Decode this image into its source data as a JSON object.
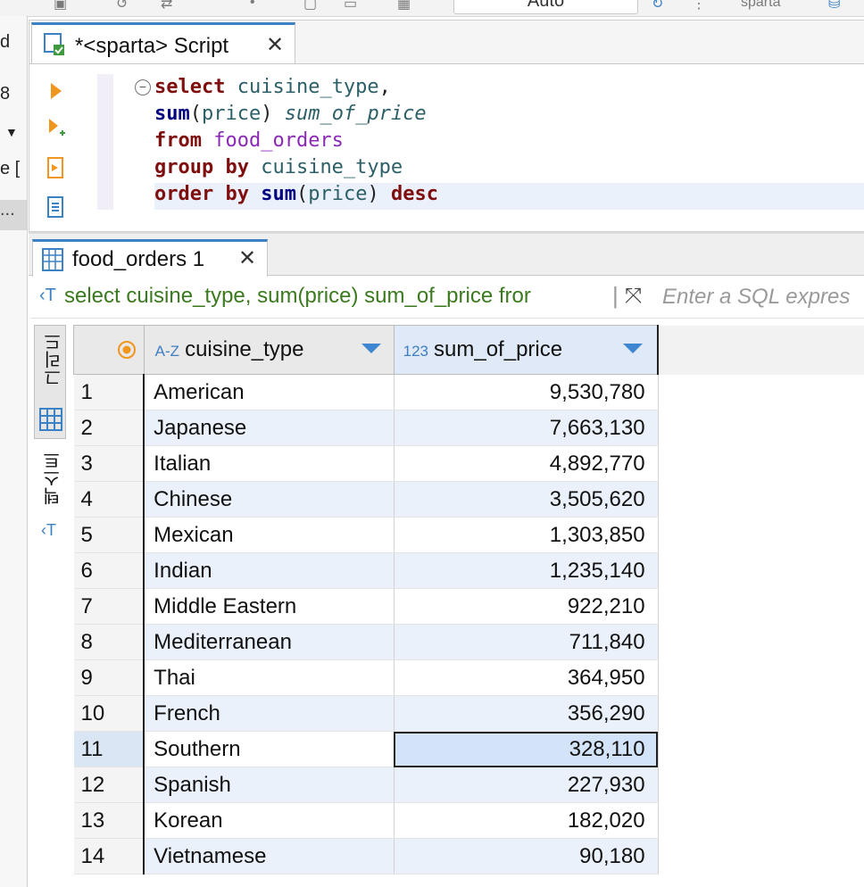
{
  "toolbar": {
    "auto_label": "Auto",
    "connection_label": "sparta"
  },
  "leftstrip": {
    "items": [
      "d",
      "8",
      "▼",
      "e [",
      "..."
    ]
  },
  "editor": {
    "tab_title": "*<sparta> Script",
    "code_lines": [
      [
        {
          "t": "select",
          "c": "kw"
        },
        {
          "t": " cuisine_type",
          "c": "col"
        },
        {
          "t": ",",
          "c": "punc"
        }
      ],
      [
        {
          "t": "sum",
          "c": "fn"
        },
        {
          "t": "(",
          "c": "punc"
        },
        {
          "t": "price",
          "c": "col"
        },
        {
          "t": ") ",
          "c": "punc"
        },
        {
          "t": "sum_of_price",
          "c": "alias"
        }
      ],
      [
        {
          "t": "from",
          "c": "kw"
        },
        {
          "t": " food_orders",
          "c": "tbl"
        }
      ],
      [
        {
          "t": "group by",
          "c": "kw"
        },
        {
          "t": " cuisine_type",
          "c": "col"
        }
      ],
      [
        {
          "t": "order by",
          "c": "kw"
        },
        {
          "t": " ",
          "c": "punc"
        },
        {
          "t": "sum",
          "c": "fn"
        },
        {
          "t": "(",
          "c": "punc"
        },
        {
          "t": "price",
          "c": "col"
        },
        {
          "t": ") ",
          "c": "punc"
        },
        {
          "t": "desc",
          "c": "kw"
        }
      ]
    ]
  },
  "results": {
    "tab_title": "food_orders 1",
    "filter_sql": "select cuisine_type, sum(price) sum_of_price fror",
    "filter_placeholder": "Enter a SQL expres",
    "side_tabs": {
      "grid": "그리드",
      "text": "텍스트"
    },
    "columns": [
      {
        "type_label": "A-Z",
        "name": "cuisine_type"
      },
      {
        "type_label": "123",
        "name": "sum_of_price"
      }
    ],
    "rows": [
      {
        "n": "1",
        "cuisine": "American",
        "sum": "9,530,780"
      },
      {
        "n": "2",
        "cuisine": "Japanese",
        "sum": "7,663,130"
      },
      {
        "n": "3",
        "cuisine": "Italian",
        "sum": "4,892,770"
      },
      {
        "n": "4",
        "cuisine": "Chinese",
        "sum": "3,505,620"
      },
      {
        "n": "5",
        "cuisine": "Mexican",
        "sum": "1,303,850"
      },
      {
        "n": "6",
        "cuisine": "Indian",
        "sum": "1,235,140"
      },
      {
        "n": "7",
        "cuisine": "Middle Eastern",
        "sum": "922,210"
      },
      {
        "n": "8",
        "cuisine": "Mediterranean",
        "sum": "711,840"
      },
      {
        "n": "9",
        "cuisine": "Thai",
        "sum": "364,950"
      },
      {
        "n": "10",
        "cuisine": "French",
        "sum": "356,290"
      },
      {
        "n": "11",
        "cuisine": "Southern",
        "sum": "328,110"
      },
      {
        "n": "12",
        "cuisine": "Spanish",
        "sum": "227,930"
      },
      {
        "n": "13",
        "cuisine": "Korean",
        "sum": "182,020"
      },
      {
        "n": "14",
        "cuisine": "Vietnamese",
        "sum": "90,180"
      }
    ],
    "selected_row": "11"
  },
  "colors": {
    "accent": "#3b82c4",
    "keyword": "#7f0e0e",
    "table_name": "#8b28b8",
    "column": "#2c5f67",
    "filter_text": "#3b7a1e"
  }
}
